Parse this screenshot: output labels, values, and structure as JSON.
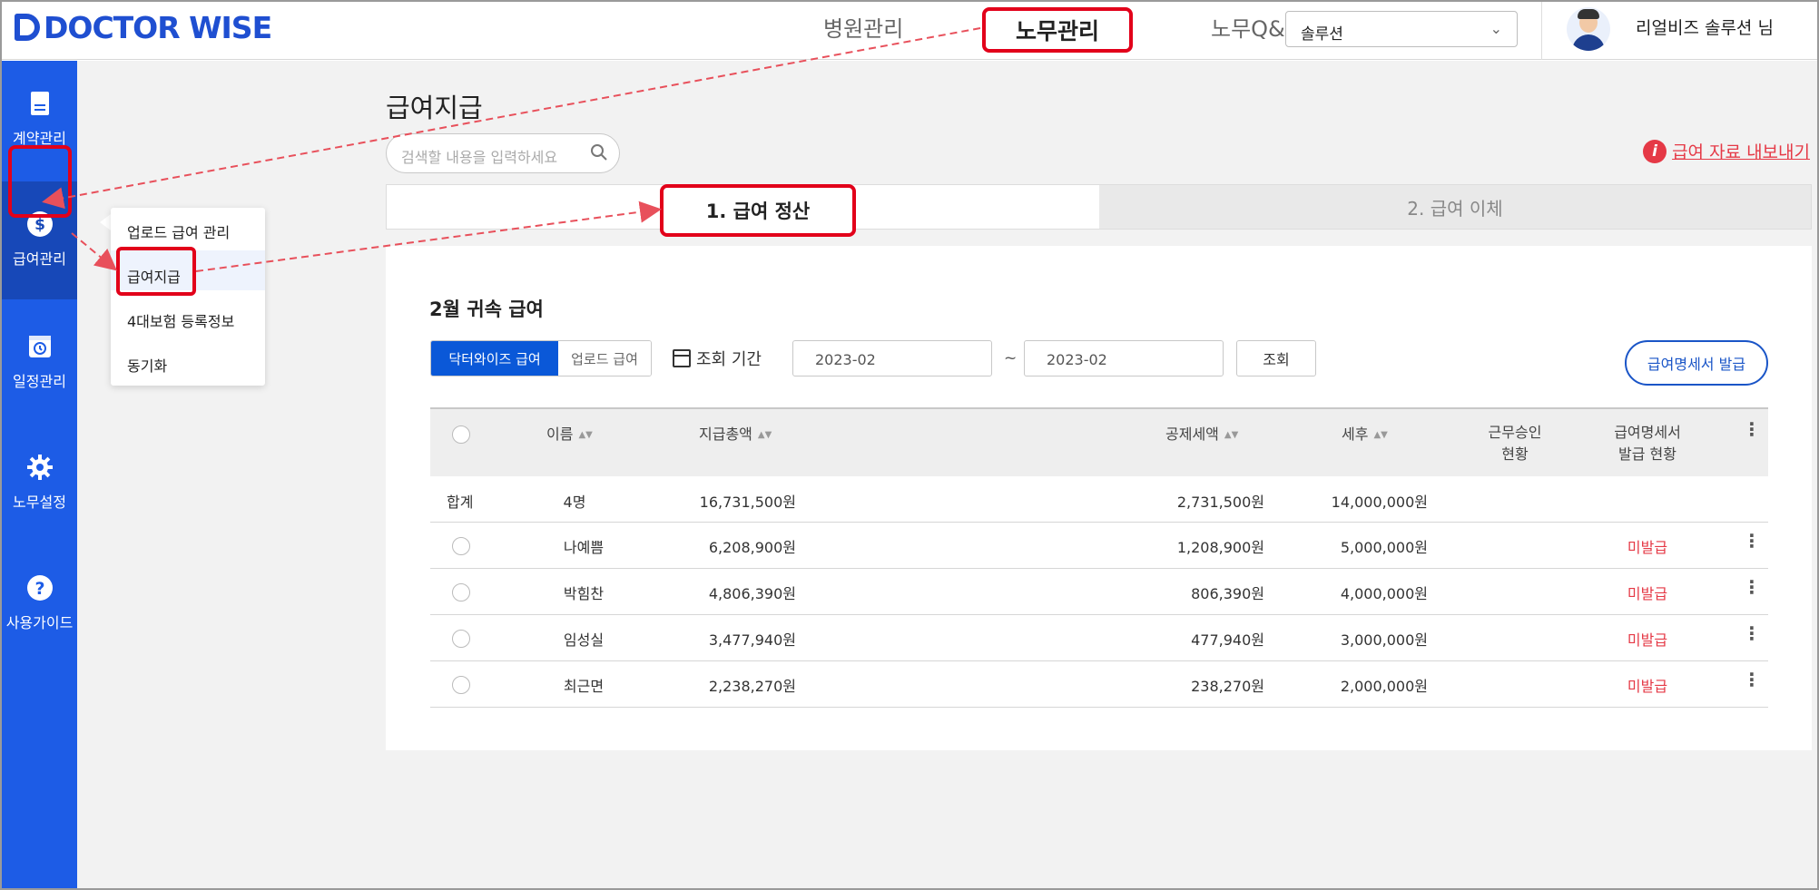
{
  "brand": {
    "name": "DOCTOR WISE",
    "color": "#1f4fd1"
  },
  "header": {
    "nav": [
      "병원관리",
      "노무관리",
      "노무Q&"
    ],
    "active_nav": "노무관리",
    "select_value": "솔루션",
    "user_name": "리얼비즈 솔루션 님"
  },
  "sidebar": {
    "items": [
      {
        "label": "계약관리",
        "icon": "document-icon"
      },
      {
        "label": "급여관리",
        "icon": "dollar-icon"
      },
      {
        "label": "일정관리",
        "icon": "calendar-clock-icon"
      },
      {
        "label": "노무설정",
        "icon": "gear-icon"
      },
      {
        "label": "사용가이드",
        "icon": "question-icon"
      }
    ],
    "active": "급여관리"
  },
  "flyout": {
    "items": [
      "업로드 급여 관리",
      "급여지급",
      "4대보험 등록정보",
      "동기화"
    ],
    "active": "급여지급"
  },
  "page": {
    "title": "급여지급",
    "search_placeholder": "검색할 내용을 입력하세요",
    "export_label": "급여 자료 내보내기",
    "tabs": [
      "1. 급여 정산",
      "2. 급여 이체"
    ]
  },
  "panel": {
    "title": "2월 귀속 급여",
    "segments": [
      "닥터와이즈 급여",
      "업로드 급여"
    ],
    "period_label": "조회 기간",
    "date_from": "2023-02",
    "date_to": "2023-02",
    "tilde": "~",
    "query_button": "조회",
    "issue_button": "급여명세서 발급"
  },
  "table": {
    "headers": {
      "name": "이름",
      "total": "지급총액",
      "deduction": "공제세액",
      "after_tax": "세후",
      "approval_1": "근무승인",
      "approval_2": "현황",
      "statement_1": "급여명세서",
      "statement_2": "발급 현황"
    },
    "summary": {
      "label": "합계",
      "count": "4명",
      "total": "16,731,500원",
      "deduction": "2,731,500원",
      "after_tax": "14,000,000원"
    },
    "rows": [
      {
        "name": "나예쁨",
        "total": "6,208,900원",
        "deduction": "1,208,900원",
        "after_tax": "5,000,000원",
        "status": "미발급"
      },
      {
        "name": "박힘찬",
        "total": "4,806,390원",
        "deduction": "806,390원",
        "after_tax": "4,000,000원",
        "status": "미발급"
      },
      {
        "name": "임성실",
        "total": "3,477,940원",
        "deduction": "477,940원",
        "after_tax": "3,000,000원",
        "status": "미발급"
      },
      {
        "name": "최근면",
        "total": "2,238,270원",
        "deduction": "238,270원",
        "after_tax": "2,000,000원",
        "status": "미발급"
      }
    ]
  },
  "colors": {
    "accent": "#1d5ce6",
    "annotation": "#e2001a",
    "status": "#e53946"
  }
}
